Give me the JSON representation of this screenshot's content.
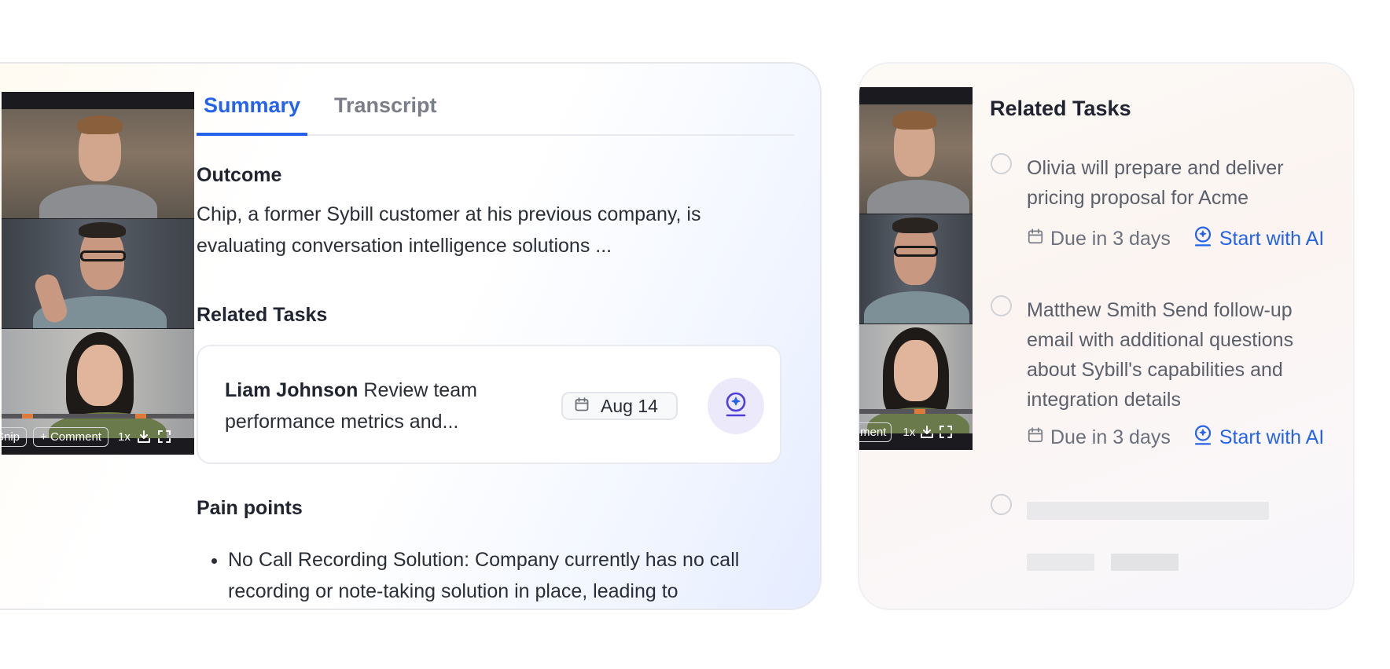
{
  "video": {
    "snip_label": "Snip",
    "comment_label": "+ Comment",
    "comment_label_cut": "ment",
    "speed_label": "1x"
  },
  "tabs": [
    {
      "label": "Summary",
      "active": true
    },
    {
      "label": "Transcript",
      "active": false
    }
  ],
  "summary": {
    "outcome_title": "Outcome",
    "outcome_text": "Chip, a former Sybill customer at his previous company, is evaluating conversation intelligence solutions ...",
    "related_tasks_title": "Related Tasks",
    "task": {
      "assignee": "Liam Johnson",
      "text": "Review team performance metrics and...",
      "date": "Aug 14"
    },
    "pain_points_title": "Pain points",
    "pain_points": [
      "No Call Recording Solution: Company currently has no call recording or note-taking solution in place, leading to"
    ]
  },
  "right_panel": {
    "title": "Related Tasks",
    "tasks": [
      {
        "text": "Olivia will prepare and deliver pricing proposal for Acme",
        "due": "Due in 3 days",
        "action": "Start with AI"
      },
      {
        "text": "Matthew Smith Send follow-up email with additional questions about Sybill's capabilities and integration details",
        "due": "Due in 3 days",
        "action": "Start with AI"
      }
    ]
  },
  "colors": {
    "accent": "#2563eb",
    "progress_mark": "#e07a3a",
    "ai_circle": "#ece9fb"
  }
}
